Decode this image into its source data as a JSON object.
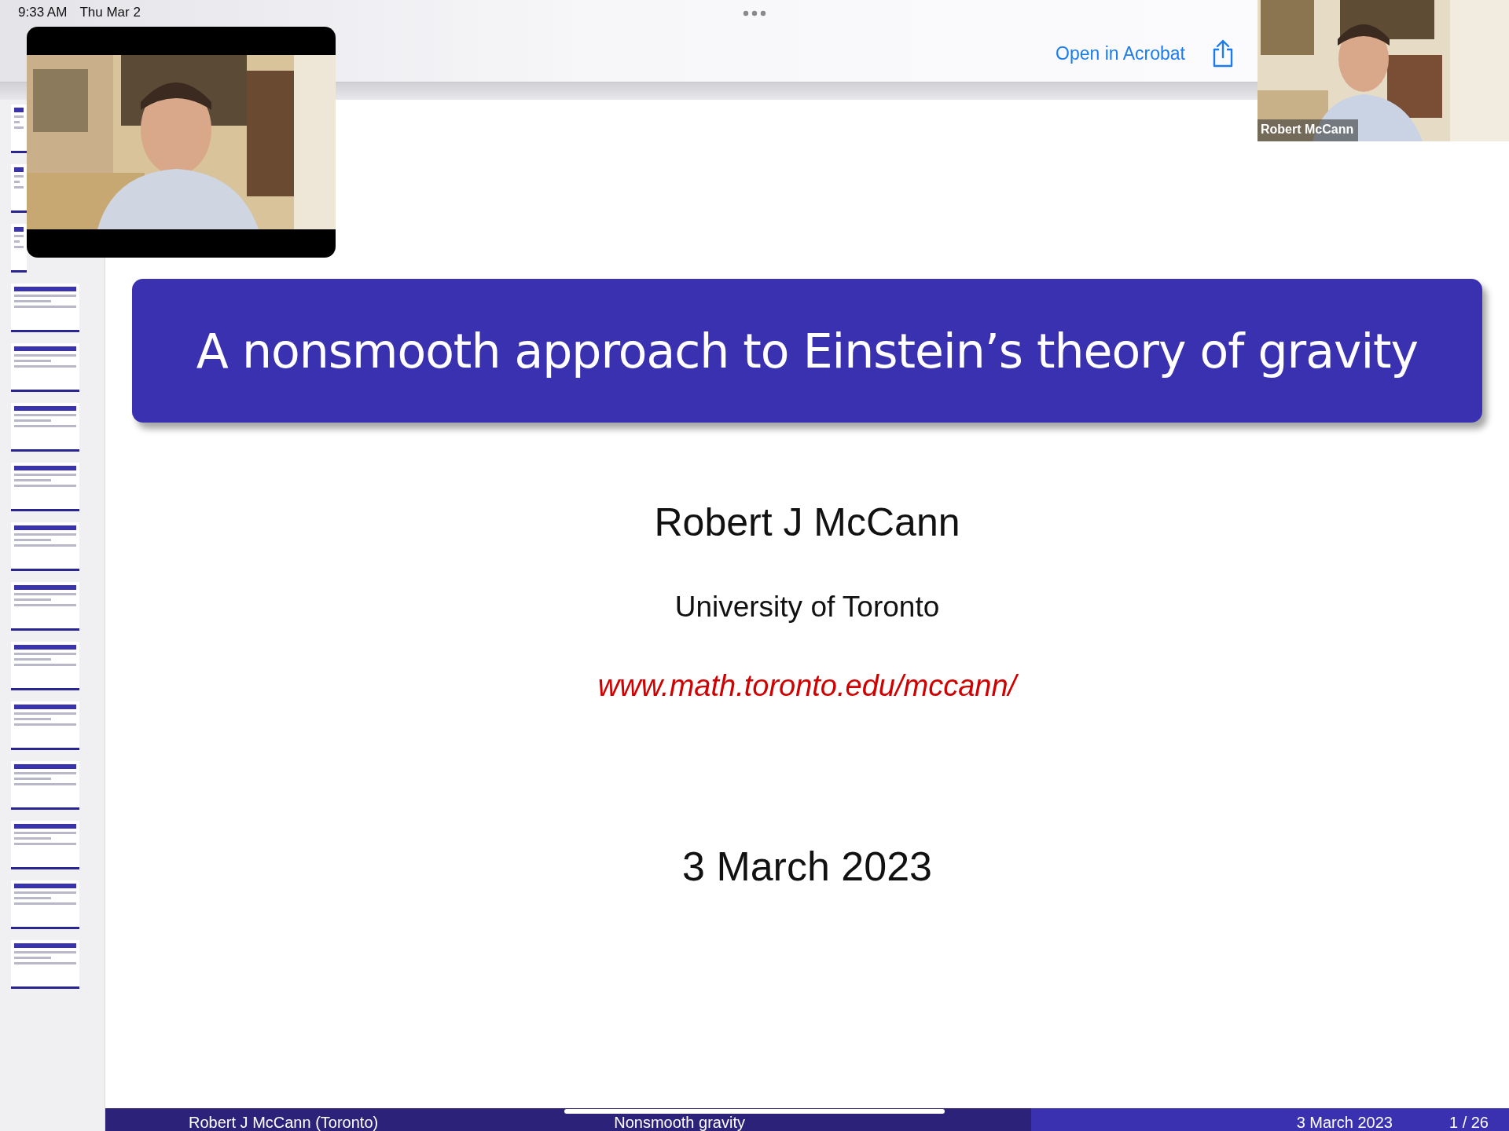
{
  "status_bar": {
    "time": "9:33 AM",
    "date": "Thu Mar 2"
  },
  "toolbar": {
    "open_button": "Open in Acrobat"
  },
  "video_tiles": [
    {
      "kind": "floating"
    },
    {
      "kind": "corner",
      "name_label": "Robert McCann"
    }
  ],
  "slide": {
    "title": "A nonsmooth approach to Einstein’s theory of gravity",
    "author": "Robert J McCann",
    "affiliation": "University of Toronto",
    "url": "www.math.toronto.edu/mccann/",
    "date": "3 March 2023",
    "footer": {
      "author": "Robert J McCann  (Toronto)",
      "short_title": "Nonsmooth gravity",
      "date": "3 March 2023",
      "page": "1 / 26"
    }
  }
}
